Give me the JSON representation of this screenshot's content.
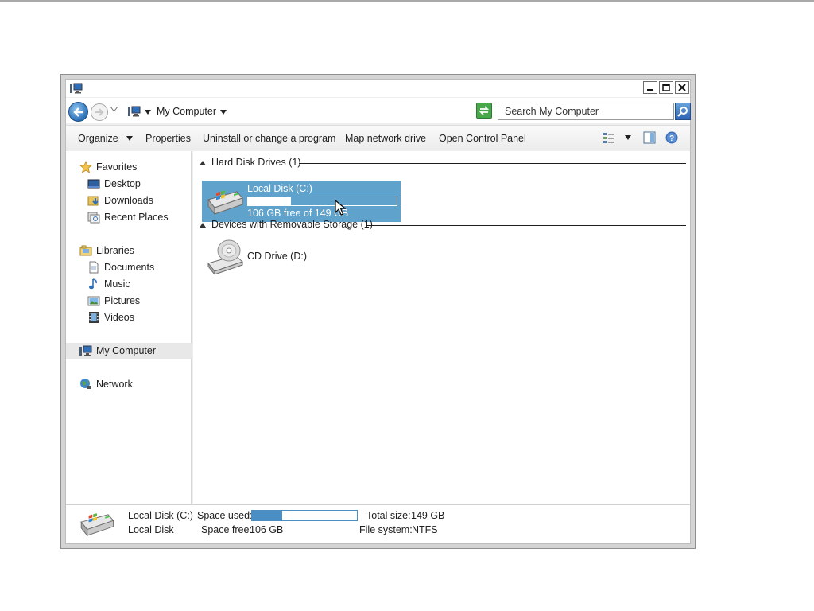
{
  "window": {
    "address": {
      "location": "My Computer"
    },
    "search": {
      "placeholder": "Search My Computer"
    }
  },
  "command_bar": {
    "items": [
      {
        "label": "Organize",
        "has_dropdown": true
      },
      {
        "label": "Properties"
      },
      {
        "label": "Uninstall or change a program"
      },
      {
        "label": "Map network drive"
      },
      {
        "label": "Open Control Panel"
      }
    ],
    "right_icons": [
      "view-options-icon",
      "preview-pane-icon",
      "help-icon"
    ]
  },
  "nav_pane": {
    "favorites": {
      "label": "Favorites",
      "items": [
        {
          "label": "Desktop",
          "icon": "desktop-icon"
        },
        {
          "label": "Downloads",
          "icon": "downloads-icon"
        },
        {
          "label": "Recent Places",
          "icon": "recent-places-icon"
        }
      ]
    },
    "libraries": {
      "label": "Libraries",
      "items": [
        {
          "label": "Documents",
          "icon": "documents-icon"
        },
        {
          "label": "Music",
          "icon": "music-icon"
        },
        {
          "label": "Pictures",
          "icon": "pictures-icon"
        },
        {
          "label": "Videos",
          "icon": "videos-icon"
        }
      ]
    },
    "computer": {
      "label": "My Computer",
      "selected": true
    },
    "network": {
      "label": "Network"
    }
  },
  "content": {
    "groups": [
      {
        "header": "Hard Disk Drives (1)",
        "items": [
          {
            "name": "Local Disk (C:)",
            "free_text": "106 GB free of 149 GB",
            "used_fraction": 0.29,
            "selected": true
          }
        ]
      },
      {
        "header": "Devices with Removable Storage (1)",
        "items": [
          {
            "name": "CD Drive (D:)"
          }
        ]
      }
    ]
  },
  "details": {
    "name": "Local Disk (C:)",
    "type": "Local Disk",
    "space_used_label": "Space used:",
    "space_used_fraction": 0.29,
    "space_free_label": "Space free:",
    "space_free_value": "106 GB",
    "total_size_label": "Total size:",
    "total_size_value": "149 GB",
    "file_system_label": "File system:",
    "file_system_value": "NTFS"
  },
  "colors": {
    "selection": "#5fa2cc",
    "usage_bar": "#4a8ec4"
  }
}
